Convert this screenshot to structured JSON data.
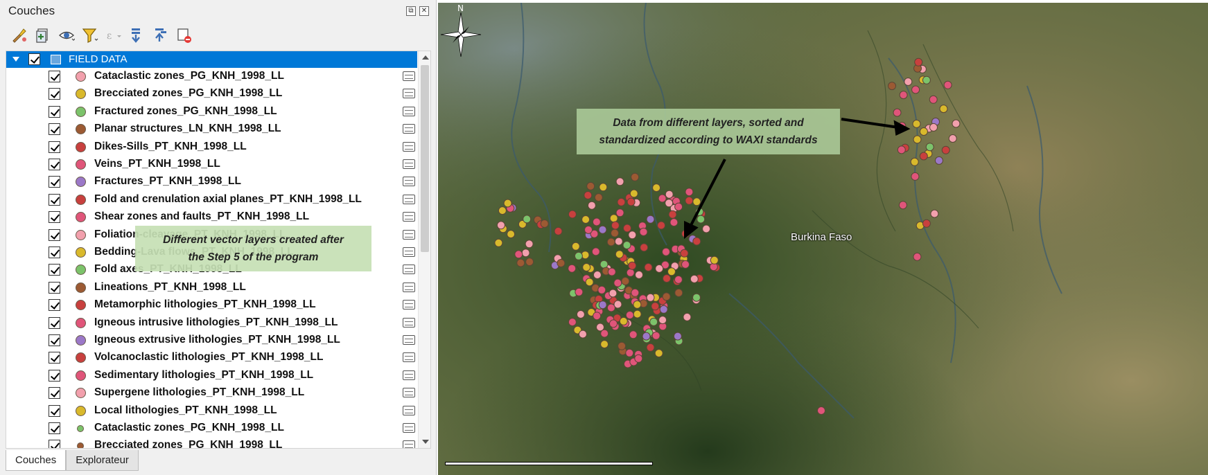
{
  "panel": {
    "title": "Couches",
    "float_glyph": "⧉",
    "close_glyph": "✕",
    "toolbar_icons": [
      "style-manager-icon",
      "add-group-icon",
      "visibility-icon",
      "filter-legend-icon",
      "filter-expression-icon",
      "expand-all-icon",
      "collapse-all-icon",
      "remove-layer-icon"
    ]
  },
  "tree": {
    "group": {
      "label": "FIELD DATA",
      "checked": true,
      "expanded": true
    },
    "layers": [
      {
        "name": "Cataclastic zones_PG_KNH_1998_LL",
        "color": "#f2a0ad",
        "small": false
      },
      {
        "name": "Brecciated zones_PG_KNH_1998_LL",
        "color": "#d9b92c",
        "small": false
      },
      {
        "name": "Fractured zones_PG_KNH_1998_LL",
        "color": "#7cc36b",
        "small": false
      },
      {
        "name": "Planar structures_LN_KNH_1998_LL",
        "color": "#9c5a33",
        "small": false
      },
      {
        "name": "Dikes-Sills_PT_KNH_1998_LL",
        "color": "#c8403e",
        "small": false
      },
      {
        "name": "Veins_PT_KNH_1998_LL",
        "color": "#e0557a",
        "small": false
      },
      {
        "name": "Fractures_PT_KNH_1998_LL",
        "color": "#9b78c8",
        "small": false
      },
      {
        "name": "Fold and crenulation axial planes_PT_KNH_1998_LL",
        "color": "#c8403e",
        "small": false
      },
      {
        "name": "Shear zones and faults_PT_KNH_1998_LL",
        "color": "#e0557a",
        "small": false
      },
      {
        "name": "Foliation-cleavage_PT_KNH_1998_LL",
        "color": "#f2a0ad",
        "small": false
      },
      {
        "name": "Bedding-Lava flows_PT_KNH_1998_LL",
        "color": "#d9b92c",
        "small": false
      },
      {
        "name": "Fold axes_PT_KNH_1998_LL",
        "color": "#7cc36b",
        "small": false
      },
      {
        "name": "Lineations_PT_KNH_1998_LL",
        "color": "#9c5a33",
        "small": false
      },
      {
        "name": "Metamorphic lithologies_PT_KNH_1998_LL",
        "color": "#c8403e",
        "small": false
      },
      {
        "name": "Igneous intrusive lithologies_PT_KNH_1998_LL",
        "color": "#e0557a",
        "small": false
      },
      {
        "name": "Igneous extrusive lithologies_PT_KNH_1998_LL",
        "color": "#9b78c8",
        "small": false
      },
      {
        "name": "Volcanoclastic lithologies_PT_KNH_1998_LL",
        "color": "#c8403e",
        "small": false
      },
      {
        "name": "Sedimentary lithologies_PT_KNH_1998_LL",
        "color": "#e0557a",
        "small": false
      },
      {
        "name": "Supergene lithologies_PT_KNH_1998_LL",
        "color": "#f2a0ad",
        "small": false
      },
      {
        "name": "Local lithologies_PT_KNH_1998_LL",
        "color": "#d9b92c",
        "small": false
      },
      {
        "name": "Cataclastic zones_PG_KNH_1998_LL",
        "color": "#7cc36b",
        "small": true
      },
      {
        "name": "Brecciated zones_PG_KNH_1998_LL",
        "color": "#9c5a33",
        "small": true
      }
    ]
  },
  "tabs": [
    {
      "label": "Couches",
      "active": true
    },
    {
      "label": "Explorateur",
      "active": false
    }
  ],
  "annotations": {
    "left_line1": "Different vector layers created after",
    "left_line2": "the Step 5 of the program",
    "right_line1": "Data from different layers, sorted and",
    "right_line2": "standardized according to WAXI standards"
  },
  "map": {
    "place_label": "Burkina Faso",
    "north_label": "N"
  }
}
